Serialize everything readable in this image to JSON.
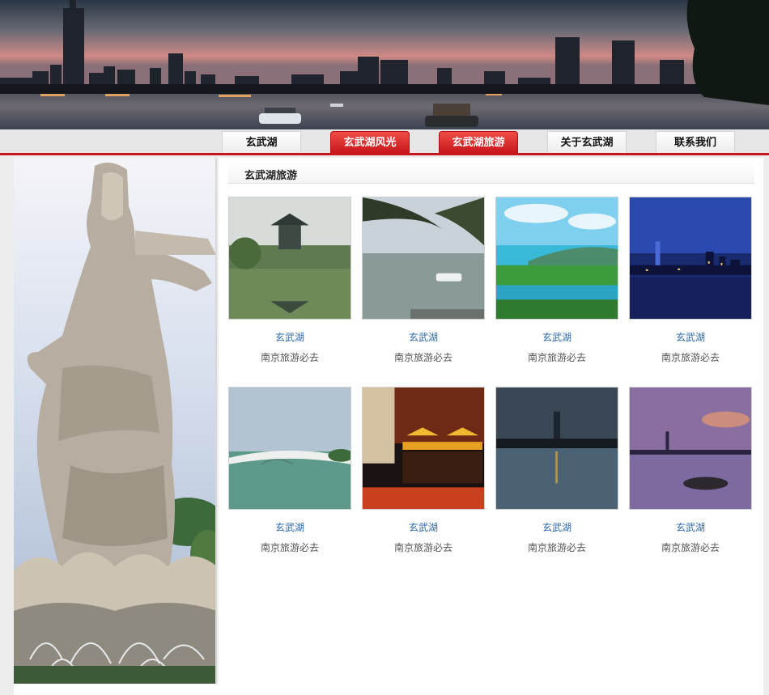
{
  "nav": {
    "items": [
      {
        "label": "玄武湖",
        "active": false
      },
      {
        "label": "玄武湖风光",
        "active": true
      },
      {
        "label": "玄武湖旅游",
        "active": true
      },
      {
        "label": "关于玄武湖",
        "active": false
      },
      {
        "label": "联系我们",
        "active": false
      }
    ]
  },
  "section": {
    "title": "玄武湖旅游"
  },
  "gallery": [
    {
      "title": "玄武湖",
      "subtitle": "南京旅游必去"
    },
    {
      "title": "玄武湖",
      "subtitle": "南京旅游必去"
    },
    {
      "title": "玄武湖",
      "subtitle": "南京旅游必去"
    },
    {
      "title": "玄武湖",
      "subtitle": "南京旅游必去"
    },
    {
      "title": "玄武湖",
      "subtitle": "南京旅游必去"
    },
    {
      "title": "玄武湖",
      "subtitle": "南京旅游必去"
    },
    {
      "title": "玄武湖",
      "subtitle": "南京旅游必去"
    },
    {
      "title": "玄武湖",
      "subtitle": "南京旅游必去"
    }
  ],
  "colors": {
    "accent": "#c8161d",
    "link": "#2a66a8",
    "page_bg": "#ededed"
  }
}
